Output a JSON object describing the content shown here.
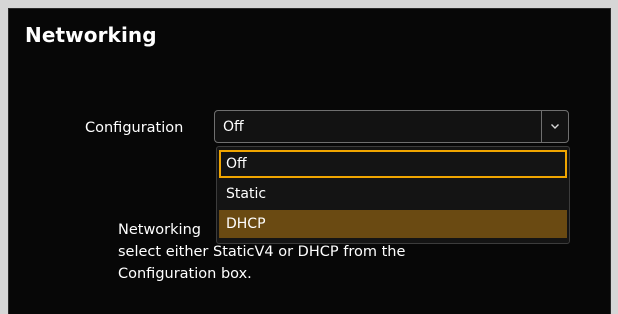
{
  "header": {
    "title": "Networking"
  },
  "form": {
    "config_label": "Configuration",
    "select_value": "Off",
    "options": [
      {
        "label": "Off",
        "state": "focused"
      },
      {
        "label": "Static",
        "state": "normal"
      },
      {
        "label": "DHCP",
        "state": "selected"
      }
    ]
  },
  "help": {
    "line1": "Networking",
    "line2": "select either StaticV4 or DHCP from the",
    "line3": "Configuration box."
  },
  "colors": {
    "focus_border": "#f0a500",
    "selected_bg": "#6a4a12",
    "panel_bg": "#070707"
  },
  "icons": {
    "dropdown_arrow": "chevron-down-icon"
  }
}
